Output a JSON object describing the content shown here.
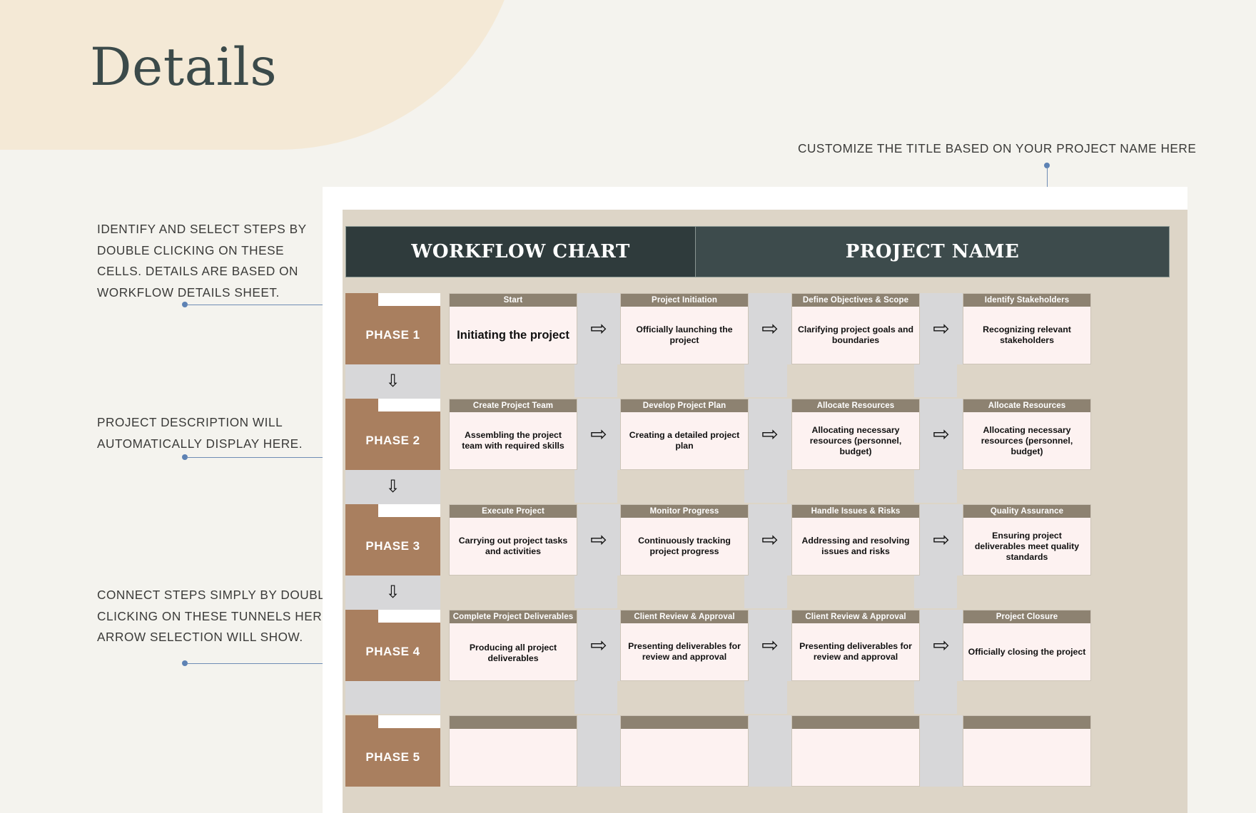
{
  "page": {
    "title": "Details",
    "background_color": "#f4f3ee",
    "blob_color": "#f4e9d6",
    "title_color": "#3b4a4a"
  },
  "annotations": {
    "top_right": "CUSTOMIZE THE TITLE BASED ON YOUR PROJECT NAME HERE",
    "left_1": "IDENTIFY AND SELECT STEPS BY DOUBLE CLICKING ON THESE CELLS. DETAILS ARE BASED ON WORKFLOW DETAILS SHEET.",
    "left_2": "PROJECT DESCRIPTION WILL AUTOMATICALLY DISPLAY HERE.",
    "left_3": "CONNECT STEPS SIMPLY BY DOUBLE CLICKING ON THESE TUNNELS HERE, ARROW SELECTION WILL SHOW.",
    "connector_color": "#6e8cb5"
  },
  "chart": {
    "header_left": "WORKFLOW CHART",
    "header_right": "PROJECT NAME",
    "header_left_color": "#2f3b3c",
    "header_right_color": "#3d4b4c",
    "phase_color": "#a97f5f",
    "step_title_color": "#8d8271",
    "step_body_color": "#fdf2f1",
    "arrow_glyph": "⇨",
    "down_arrow_glyph": "⇩",
    "rows": [
      {
        "phase": "PHASE 1",
        "steps": [
          {
            "title": "Start",
            "body": "Initiating the project",
            "big": true
          },
          {
            "title": "Project Initiation",
            "body": "Officially launching the project"
          },
          {
            "title": "Define Objectives & Scope",
            "body": "Clarifying project goals and boundaries"
          },
          {
            "title": "Identify Stakeholders",
            "body": "Recognizing relevant stakeholders"
          }
        ]
      },
      {
        "phase": "PHASE 2",
        "steps": [
          {
            "title": "Create Project Team",
            "body": "Assembling the project team with required skills"
          },
          {
            "title": "Develop Project Plan",
            "body": "Creating a detailed project plan"
          },
          {
            "title": "Allocate Resources",
            "body": "Allocating necessary resources (personnel, budget)"
          },
          {
            "title": "Allocate Resources",
            "body": "Allocating necessary resources (personnel, budget)"
          }
        ]
      },
      {
        "phase": "PHASE 3",
        "steps": [
          {
            "title": "Execute Project",
            "body": "Carrying out project tasks and activities"
          },
          {
            "title": "Monitor Progress",
            "body": "Continuously tracking project progress"
          },
          {
            "title": "Handle Issues & Risks",
            "body": "Addressing and resolving issues and risks"
          },
          {
            "title": "Quality Assurance",
            "body": "Ensuring project deliverables meet quality standards"
          }
        ]
      },
      {
        "phase": "PHASE 4",
        "steps": [
          {
            "title": "Complete Project Deliverables",
            "body": "Producing all project deliverables",
            "upper": true
          },
          {
            "title": "Client Review & Approval",
            "body": "Presenting deliverables for review and approval"
          },
          {
            "title": "Client Review & Approval",
            "body": "Presenting deliverables for review and approval"
          },
          {
            "title": "Project Closure",
            "body": "Officially closing the project"
          }
        ]
      },
      {
        "phase": "PHASE 5",
        "steps": [
          {
            "title": "",
            "body": ""
          },
          {
            "title": "",
            "body": ""
          },
          {
            "title": "",
            "body": ""
          },
          {
            "title": "",
            "body": ""
          }
        ]
      }
    ]
  }
}
